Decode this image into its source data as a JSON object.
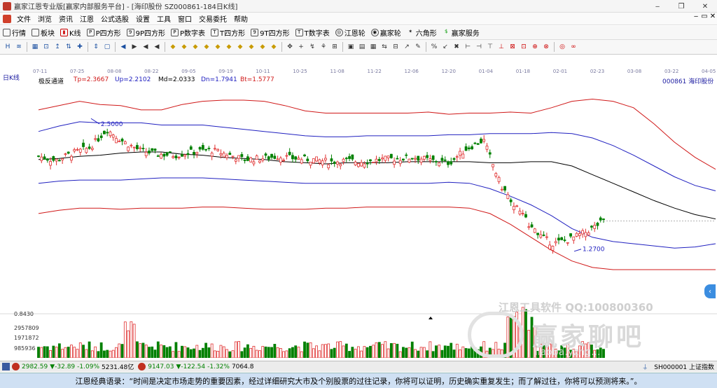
{
  "window": {
    "title": "赢家江恩专业版[赢家内部服务平台] - [海印股份  SZ000861-184日K线]",
    "controls": [
      "‒",
      "❐",
      "✕"
    ]
  },
  "menu": {
    "items": [
      "文件",
      "浏览",
      "资讯",
      "江恩",
      "公式选股",
      "设置",
      "工具",
      "窗口",
      "交易委托",
      "帮助"
    ],
    "right": [
      "‒",
      "▭",
      "✕"
    ]
  },
  "toolbar1": {
    "items": [
      "行情",
      "板块",
      "K线",
      "P四方形",
      "9P四方形",
      "P数字表",
      "T四方形",
      "9T四方形",
      "T数字表",
      "江恩轮",
      "赢家轮",
      "六角形",
      "赢家服务"
    ],
    "icons": [
      "grid-icon",
      "blocks-icon",
      "kline-icon",
      "p-square-icon",
      "9p-square-icon",
      "p-number-icon",
      "t-square-icon",
      "9t-square-icon",
      "t-number-icon",
      "gann-wheel-icon",
      "winner-wheel-icon",
      "hexagon-icon",
      "service-icon"
    ]
  },
  "toolbar2": {
    "tools": [
      "H",
      "≋",
      "▦",
      "⊡",
      "↥",
      "⇅",
      "✚",
      "⇕",
      "▢",
      "◀",
      "▶",
      "◀",
      "◀",
      "◆",
      "◆",
      "◆",
      "◆",
      "◆",
      "◆",
      "◆",
      "◆",
      "◆",
      "◆",
      "✥",
      "+",
      "↯",
      "⚘",
      "⊞",
      "▣",
      "▤",
      "▦",
      "⇆",
      "⊟",
      "↗",
      "✎",
      "%",
      "↙",
      "✖",
      "⊢",
      "⊣",
      "⊤",
      "⊥",
      "⊠",
      "⊡",
      "⊕",
      "⊗",
      "◎",
      "∞"
    ]
  },
  "chart_header": {
    "period_label": "日K线",
    "indicator_name": "极反通道",
    "tp": "Tp=2.3667",
    "up": "Up=2.2102",
    "md": "Md=2.0333",
    "dn": "Dn=1.7941",
    "bt": "Bt=1.5777",
    "stock": "000861  海印股份"
  },
  "date_axis": [
    "07-11",
    "07-25",
    "08-08",
    "08-22",
    "09-05",
    "09-19",
    "10-11",
    "10-25",
    "11-08",
    "11-22",
    "12-06",
    "12-20",
    "01-04",
    "01-18",
    "02-01",
    "02-23",
    "03-08",
    "03-22",
    "04-05"
  ],
  "annotations": {
    "high": "2.5000",
    "low": "1.2700"
  },
  "volume_axis": {
    "top": "0.8430",
    "labels": [
      "2957809",
      "1971872",
      "985936"
    ]
  },
  "watermark": {
    "brand": "江恩工具软件  QQ:100800360",
    "big": "赢家聊吧",
    "url": "liaoba.yzhg..."
  },
  "status": {
    "sh_index": "2982.59",
    "sh_change": "▼-32.89",
    "sh_pct": "-1.09%",
    "sh_amount": "5231.48亿",
    "sz_index": "9147.03",
    "sz_change": "▼-122.54",
    "sz_pct": "-1.32%",
    "sz_amount": "7064.8",
    "ticker": "SH000001 上证指数"
  },
  "quote": "江恩经典语录：“时间是决定市场走势的重要因素，经过详细研究大市及个别股票的过往记录，你将可以证明，历史确实重复发生；而了解过往，你将可以预测将来。”。",
  "colors": {
    "up_candle": "#e03030",
    "down_candle": "#008000",
    "tp_line": "#d01818",
    "up_line": "#2020c0",
    "md_line": "#000000"
  },
  "chart_data": {
    "type": "candlestick",
    "title": "000861  海印股份",
    "xlabel": "",
    "ylabel": "",
    "x_ticks": [
      "07-11",
      "07-25",
      "08-08",
      "08-22",
      "09-05",
      "09-19",
      "10-11",
      "10-25",
      "11-08",
      "11-22",
      "12-06",
      "12-20",
      "01-04",
      "01-18",
      "02-01",
      "02-23",
      "03-08",
      "03-22",
      "04-05"
    ],
    "ylim": [
      1.1,
      2.8
    ],
    "channel_last": {
      "Tp": 2.3667,
      "Up": 2.2102,
      "Md": 2.0333,
      "Dn": 1.7941,
      "Bt": 1.5777
    },
    "marked_high": 2.5,
    "marked_low": 1.27,
    "volume_ticks": [
      2957809,
      1971872,
      985936
    ],
    "series": [
      {
        "name": "Tp",
        "values": [
          2.58,
          2.62,
          2.66,
          2.63,
          2.62,
          2.58,
          2.58,
          2.63,
          2.66,
          2.67,
          2.67,
          2.66,
          2.62,
          2.57,
          2.55,
          2.55,
          2.55,
          2.55,
          2.55,
          2.56,
          2.54,
          2.55,
          2.55,
          2.56,
          2.55,
          2.6,
          2.66,
          2.68,
          2.66,
          2.6,
          2.45,
          2.28,
          2.14,
          2.03
        ]
      },
      {
        "name": "Up",
        "values": [
          2.38,
          2.43,
          2.47,
          2.46,
          2.46,
          2.46,
          2.44,
          2.44,
          2.44,
          2.42,
          2.4,
          2.38,
          2.36,
          2.34,
          2.33,
          2.33,
          2.34,
          2.34,
          2.34,
          2.34,
          2.35,
          2.35,
          2.36,
          2.36,
          2.36,
          2.37,
          2.36,
          2.32,
          2.25,
          2.16,
          2.06,
          1.96,
          1.88,
          1.83
        ]
      },
      {
        "name": "Md",
        "values": [
          2.12,
          2.13,
          2.15,
          2.16,
          2.18,
          2.19,
          2.19,
          2.17,
          2.16,
          2.14,
          2.13,
          2.12,
          2.1,
          2.09,
          2.08,
          2.09,
          2.09,
          2.09,
          2.1,
          2.1,
          2.1,
          2.1,
          2.09,
          2.09,
          2.1,
          2.1,
          2.06,
          1.98,
          1.9,
          1.82,
          1.74,
          1.67,
          1.61,
          1.57
        ]
      },
      {
        "name": "Dn",
        "values": [
          1.9,
          1.92,
          1.93,
          1.93,
          1.93,
          1.94,
          1.95,
          1.95,
          1.95,
          1.94,
          1.93,
          1.92,
          1.91,
          1.9,
          1.9,
          1.9,
          1.9,
          1.9,
          1.9,
          1.9,
          1.91,
          1.9,
          1.85,
          1.78,
          1.7,
          1.6,
          1.48,
          1.4,
          1.36,
          1.34,
          1.32,
          1.3,
          1.31,
          1.34
        ]
      },
      {
        "name": "Bt",
        "values": [
          1.62,
          1.65,
          1.67,
          1.67,
          1.66,
          1.67,
          1.67,
          1.67,
          1.68,
          1.68,
          1.67,
          1.66,
          1.66,
          1.66,
          1.67,
          1.67,
          1.68,
          1.68,
          1.68,
          1.68,
          1.68,
          1.67,
          1.62,
          1.52,
          1.4,
          1.28,
          1.18,
          1.12,
          1.1,
          1.1,
          1.1,
          1.1,
          1.1,
          1.1
        ]
      }
    ],
    "close_path": [
      2.15,
      2.11,
      2.18,
      2.23,
      2.4,
      2.28,
      2.2,
      2.17,
      2.16,
      2.19,
      2.21,
      2.17,
      2.12,
      2.13,
      2.15,
      2.13,
      2.12,
      2.1,
      2.11,
      2.1,
      2.12,
      2.13,
      2.14,
      2.11,
      2.09,
      2.22,
      2.3,
      1.88,
      1.66,
      1.45,
      1.34,
      1.38,
      1.45,
      1.55
    ]
  }
}
